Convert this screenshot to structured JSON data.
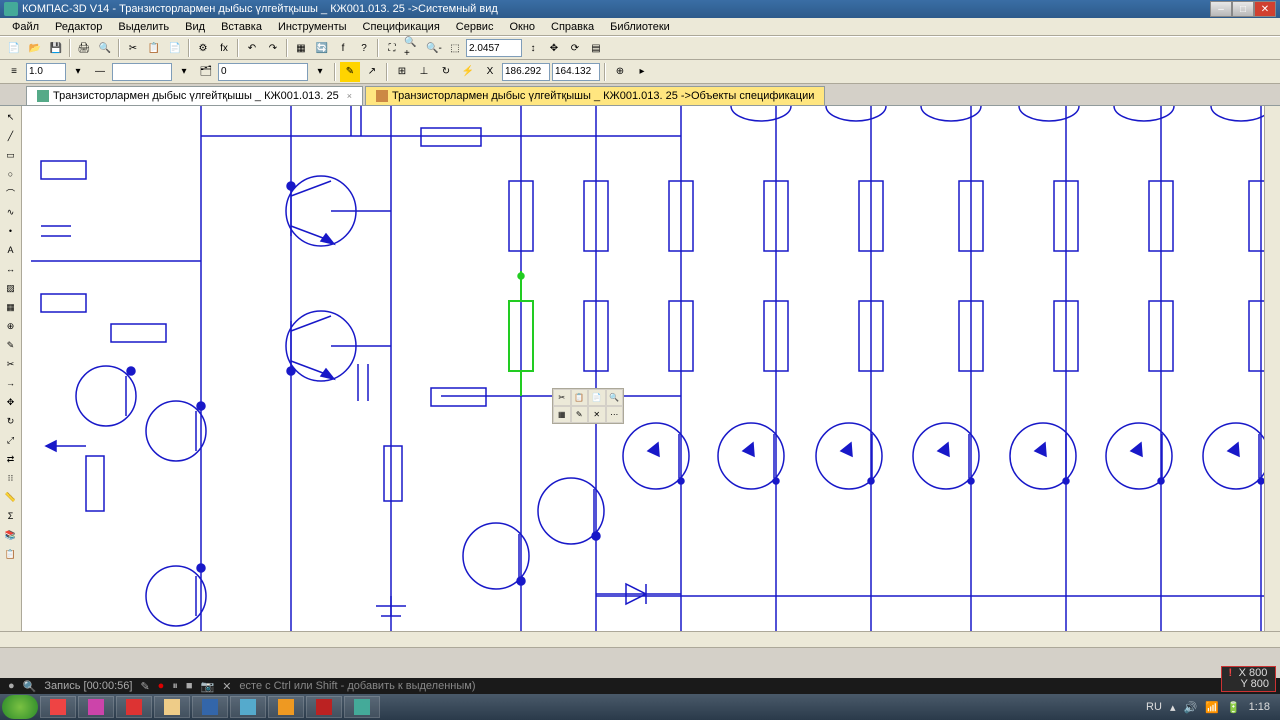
{
  "title": {
    "app": "КОМПАС-3D V14",
    "doc": "Транзисторлармен дыбыс үлгейтқышы _ КЖ001.013. 25 ->Системный вид"
  },
  "menu": [
    "Файл",
    "Редактор",
    "Выделить",
    "Вид",
    "Вставка",
    "Инструменты",
    "Спецификация",
    "Сервис",
    "Окно",
    "Справка",
    "Библиотеки"
  ],
  "toolbar1": {
    "zoom": "2.0457"
  },
  "toolbar2": {
    "scale": "1.0",
    "layer_num": "0",
    "coord_x": "186.292",
    "coord_y": "164.132"
  },
  "tabs": [
    {
      "label": "Транзисторлармен дыбыс үлгейтқышы _ КЖ001.013. 25",
      "active": true
    },
    {
      "label": "Транзисторлармен дыбыс үлгейтқышы _ КЖ001.013. 25 ->Объекты спецификации",
      "highlight": true
    }
  ],
  "lefttools_count": 24,
  "floating_toolbar_count": 8,
  "recorder": {
    "label": "Запись [00:00:56]",
    "hint": "есте с Ctrl или Shift - добавить к выделенным)"
  },
  "coord_overlay": {
    "x": "X 800",
    "y": "Y 800"
  },
  "systray": {
    "lang": "RU",
    "time": "1:18"
  },
  "taskbar_items": 9
}
